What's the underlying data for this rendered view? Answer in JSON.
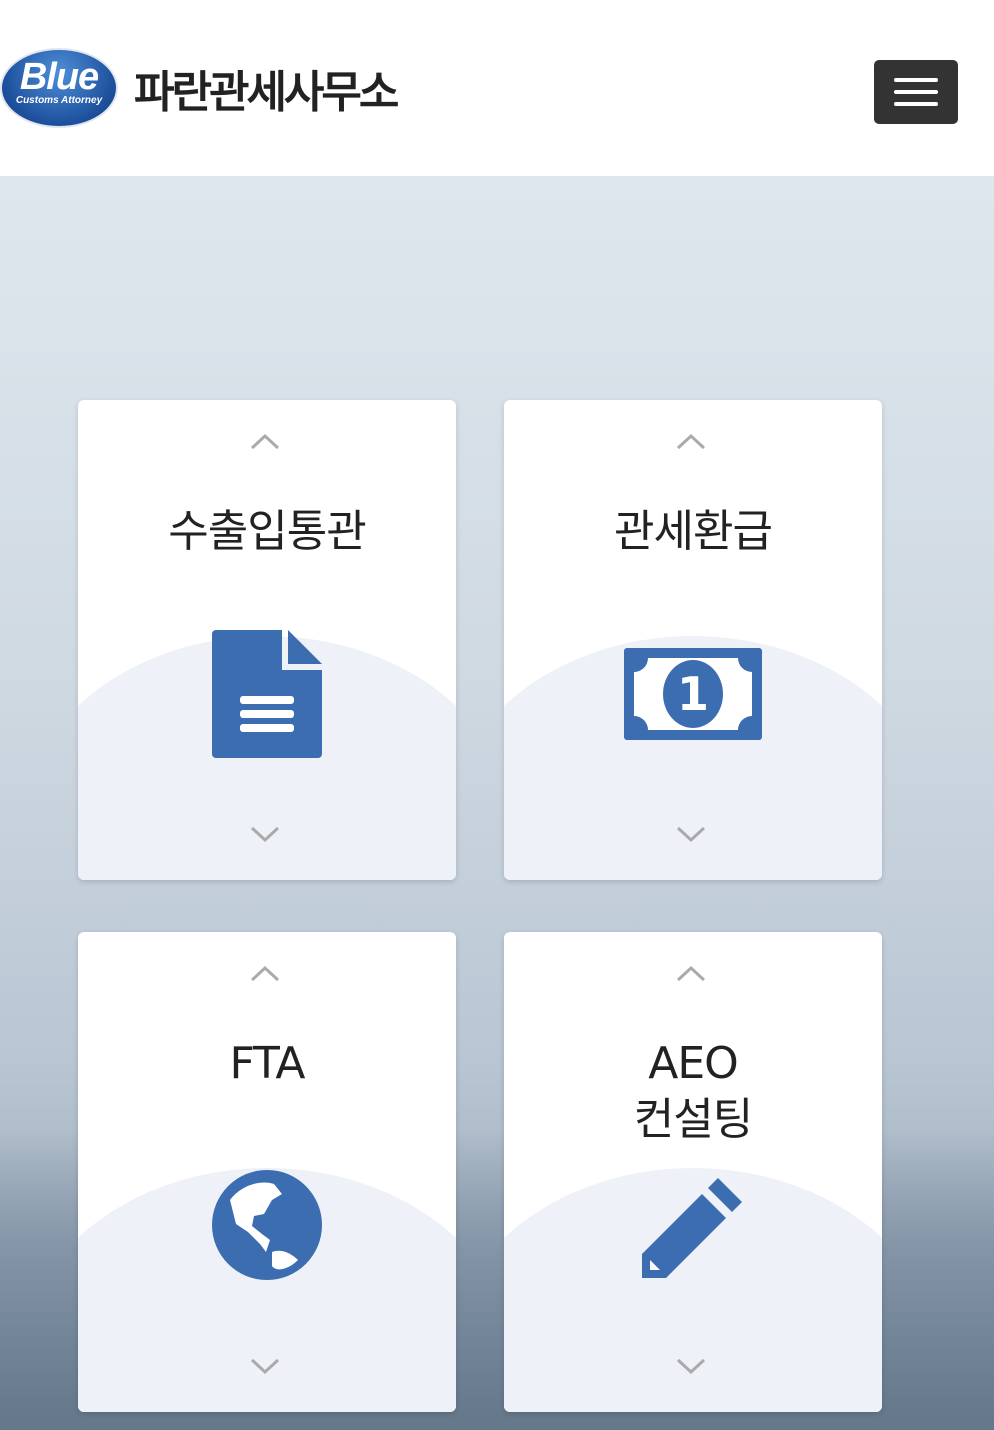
{
  "header": {
    "logo_text": "Blue",
    "logo_sub": "Customs Attorney",
    "brand": "파란관세사무소"
  },
  "cards": [
    {
      "title": "수출입통관",
      "icon": "document-icon"
    },
    {
      "title": "관세환급",
      "icon": "money-bill-icon"
    },
    {
      "title": "FTA",
      "icon": "globe-icon"
    },
    {
      "title_line1": "AEO",
      "title_line2": "컨설팅",
      "icon": "pencil-icon"
    }
  ],
  "colors": {
    "icon": "#3b6db0",
    "menu": "#333333"
  }
}
